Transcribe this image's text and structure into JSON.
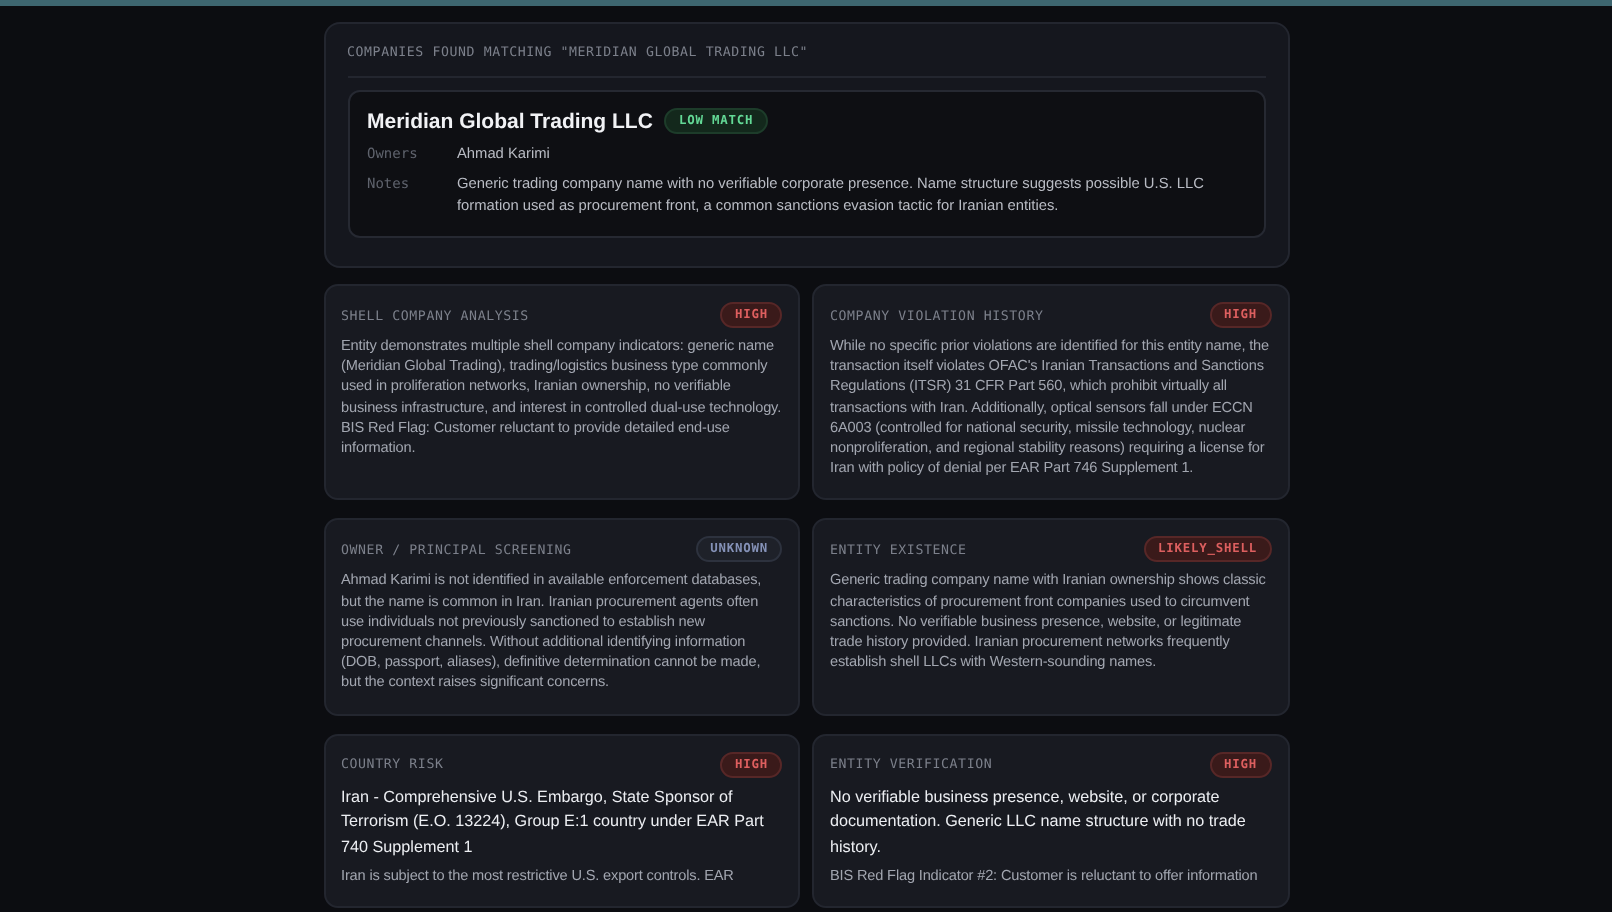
{
  "results": {
    "heading": "COMPANIES FOUND MATCHING \"MERIDIAN GLOBAL TRADING LLC\"",
    "company": {
      "name": "Meridian Global Trading LLC",
      "badge": {
        "label": "LOW MATCH",
        "color": "#13281c"
      },
      "fields": [
        {
          "label": "Owners",
          "value": "Ahmad Karimi"
        },
        {
          "label": "Notes",
          "value": "Generic trading company name with no verifiable corporate presence. Name structure suggests possible U.S. LLC formation used as procurement front, a common sanctions evasion tactic for Iranian entities."
        }
      ]
    }
  },
  "findings": [
    {
      "title": "SHELL COMPANY ANALYSIS",
      "badge": {
        "label": "HIGH",
        "color": "#3a1a1a"
      },
      "body": "Entity demonstrates multiple shell company indicators: generic name (Meridian Global Trading), trading/logistics business type commonly used in proliferation networks, Iranian ownership, no verifiable business infrastructure, and interest in controlled dual-use technology. BIS Red Flag: Customer reluctant to provide detailed end-use information."
    },
    {
      "title": "COMPANY VIOLATION HISTORY",
      "badge": {
        "label": "HIGH",
        "color": "#3a1a1a"
      },
      "body": "While no specific prior violations are identified for this entity name, the transaction itself violates OFAC's Iranian Transactions and Sanctions Regulations (ITSR) 31 CFR Part 560, which prohibit virtually all transactions with Iran. Additionally, optical sensors fall under ECCN 6A003 (controlled for national security, missile technology, nuclear nonproliferation, and regional stability reasons) requiring a license for Iran with policy of denial per EAR Part 746 Supplement 1."
    },
    {
      "title": "OWNER / PRINCIPAL SCREENING",
      "badge": {
        "label": "UNKNOWN",
        "color": "#1e2129"
      },
      "body": "Ahmad Karimi is not identified in available enforcement databases, but the name is common in Iran. Iranian procurement agents often use individuals not previously sanctioned to establish new procurement channels. Without additional identifying information (DOB, passport, aliases), definitive determination cannot be made, but the context raises significant concerns."
    },
    {
      "title": "ENTITY EXISTENCE",
      "badge": {
        "label": "LIKELY_SHELL",
        "color": "#3a1a1a"
      },
      "body": "Generic trading company name with Iranian ownership shows classic characteristics of procurement front companies used to circumvent sanctions. No verifiable business presence, website, or legitimate trade history provided. Iranian procurement networks frequently establish shell LLCs with Western-sounding names."
    },
    {
      "title": "COUNTRY RISK",
      "badge": {
        "label": "HIGH",
        "color": "#3a1a1a"
      },
      "headline": "Iran - Comprehensive U.S. Embargo, State Sponsor of Terrorism (E.O. 13224), Group E:1 country under EAR Part 740 Supplement 1",
      "body": "Iran is subject to the most restrictive U.S. export controls. EAR"
    },
    {
      "title": "ENTITY VERIFICATION",
      "badge": {
        "label": "HIGH",
        "color": "#3a1a1a"
      },
      "headline": "No verifiable business presence, website, or corporate documentation. Generic LLC name structure with no trade history.",
      "body": "BIS Red Flag Indicator #2: Customer is reluctant to offer information"
    }
  ]
}
